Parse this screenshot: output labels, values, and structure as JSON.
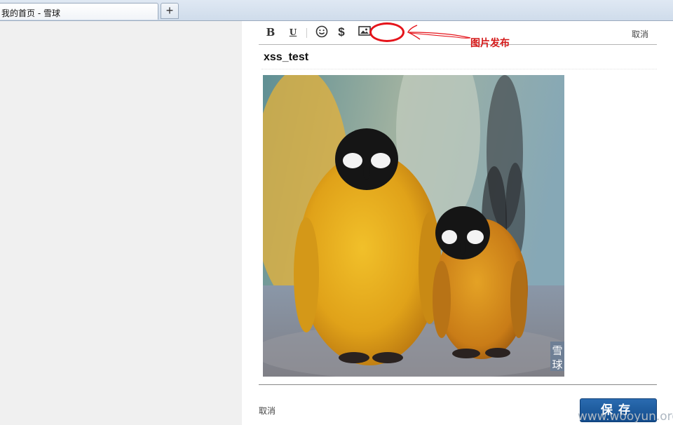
{
  "browser": {
    "tab_title": "我的首页 - 雪球",
    "new_tab_symbol": "+"
  },
  "toolbar": {
    "bold_label": "B",
    "underline_label": "U",
    "emoji_icon": "smiley-icon",
    "dollar_label": "$",
    "image_icon": "image-icon",
    "cancel_label": "取消"
  },
  "annotation": {
    "label": "图片发布",
    "color": "#d41818"
  },
  "post": {
    "title": "xss_test",
    "image_watermark": [
      "雪",
      "球"
    ]
  },
  "footer": {
    "cancel_label": "取消",
    "save_label": "保存",
    "save_color": "#1b5a9e"
  },
  "page_watermark": "www.wooyun.org"
}
